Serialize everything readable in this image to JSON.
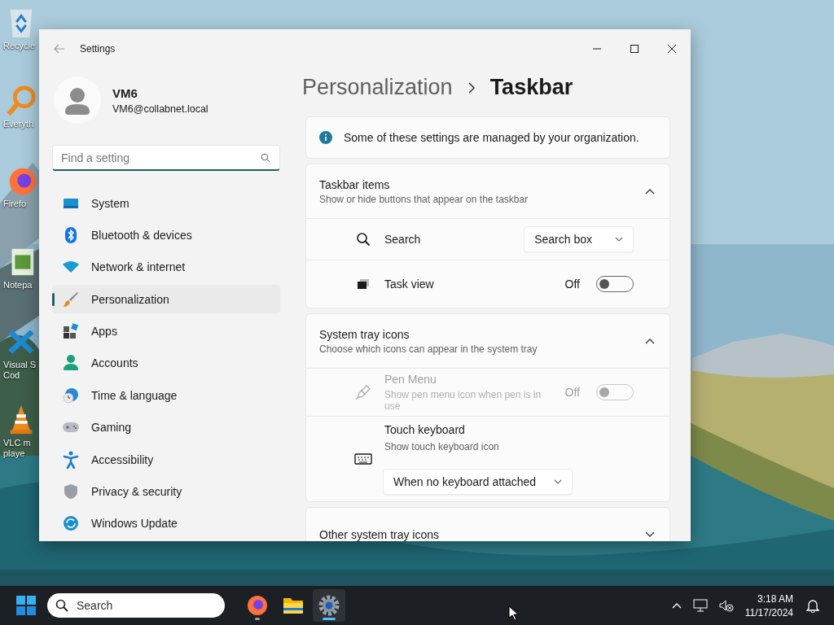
{
  "desktop_icons": [
    {
      "kind": "recycle",
      "lines": [
        "Recycle"
      ]
    },
    {
      "kind": "magnifier",
      "lines": [
        "Everyth"
      ]
    },
    {
      "kind": "firefox",
      "lines": [
        "Firefo"
      ]
    },
    {
      "kind": "notepad",
      "lines": [
        "Notepa"
      ]
    },
    {
      "kind": "vscode",
      "lines": [
        "Visual S",
        "Cod"
      ]
    },
    {
      "kind": "vlc",
      "lines": [
        "VLC m",
        "playe"
      ]
    }
  ],
  "window": {
    "title": "Settings"
  },
  "user": {
    "name": "VM6",
    "email": "VM6@collabnet.local"
  },
  "search": {
    "placeholder": "Find a setting"
  },
  "nav": [
    {
      "kind": "system",
      "label": "System",
      "selected": false
    },
    {
      "kind": "bluetooth",
      "label": "Bluetooth & devices",
      "selected": false
    },
    {
      "kind": "network",
      "label": "Network & internet",
      "selected": false
    },
    {
      "kind": "brush",
      "label": "Personalization",
      "selected": true
    },
    {
      "kind": "apps",
      "label": "Apps",
      "selected": false
    },
    {
      "kind": "accounts",
      "label": "Accounts",
      "selected": false
    },
    {
      "kind": "time",
      "label": "Time & language",
      "selected": false
    },
    {
      "kind": "gaming",
      "label": "Gaming",
      "selected": false
    },
    {
      "kind": "accessibility",
      "label": "Accessibility",
      "selected": false
    },
    {
      "kind": "privacy",
      "label": "Privacy & security",
      "selected": false
    },
    {
      "kind": "update",
      "label": "Windows Update",
      "selected": false
    }
  ],
  "breadcrumb": [
    "Personalization",
    "Taskbar"
  ],
  "notice": "Some of these settings are managed by your organization.",
  "sections": [
    {
      "title": "Taskbar items",
      "subtitle": "Show or hide buttons that appear on the taskbar",
      "expanded": true,
      "rows": [
        {
          "kind": "dropdown",
          "label": "Search",
          "value": "Search box",
          "disabled": false
        },
        {
          "kind": "toggle",
          "label": "Task view",
          "state_label": "Off",
          "on": false,
          "disabled": false
        }
      ]
    },
    {
      "title": "System tray icons",
      "subtitle": "Choose which icons can appear in the system tray",
      "expanded": true,
      "rows": [
        {
          "kind": "toggle",
          "label": "Pen Menu",
          "description": "Show pen menu icon when pen is in use",
          "state_label": "Off",
          "on": false,
          "disabled": true
        },
        {
          "kind": "dropdown-below",
          "label": "Touch keyboard",
          "description": "Show touch keyboard icon",
          "value": "When no keyboard attached",
          "disabled": false
        }
      ]
    },
    {
      "title": "Other system tray icons",
      "expanded": false
    }
  ],
  "taskbar": {
    "search_placeholder": "Search",
    "apps": [
      {
        "kind": "firefox",
        "running": true,
        "active": false
      },
      {
        "kind": "folder",
        "running": false,
        "active": false
      },
      {
        "kind": "gear",
        "running": true,
        "active": true
      }
    ],
    "time": "3:18 AM",
    "date": "11/17/2024"
  }
}
